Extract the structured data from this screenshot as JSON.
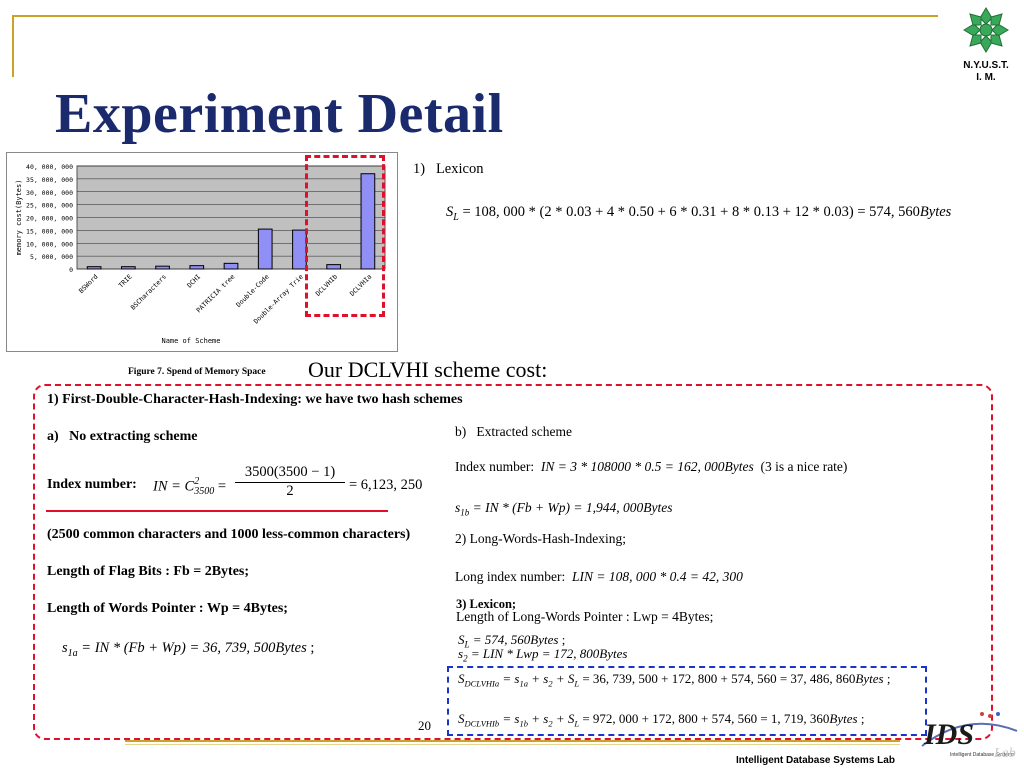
{
  "slide": {
    "title": "Experiment Detail",
    "org_logo_text": [
      "N.Y.U.S.T.",
      "I. M."
    ],
    "page_number": "20",
    "footer": "Intelligent Database Systems Lab",
    "ids_logo_text": "IDS",
    "ids_logo_sub": "Intelligent Database Systems",
    "ids_logo_lab": "Lab"
  },
  "figure": {
    "caption": "Figure 7. Spend of Memory Space"
  },
  "chart_data": {
    "type": "bar",
    "categories": [
      "BSWord",
      "TRIE",
      "BSCharacters",
      "DCHI",
      "PATRICIA tree",
      "Double-Code",
      "Double-Array Trie",
      "DCLVHIb",
      "DCLVHIa"
    ],
    "values": [
      900000,
      900000,
      1100000,
      1300000,
      2200000,
      15500000,
      15100000,
      1700000,
      37000000
    ],
    "ylim": [
      0,
      40000000
    ],
    "yticks": [
      "0",
      "5, 000, 000",
      "10, 000, 000",
      "15, 000, 000",
      "20, 000, 000",
      "25, 000, 000",
      "30, 000, 000",
      "35, 000, 000",
      "40, 000, 000"
    ],
    "ylabel": "memory cost(Bytes)",
    "xlabel": "Name of Scheme",
    "grid": true,
    "bar_color": "#8f8ff5",
    "plot_bg": "#c0c0c0"
  },
  "content": {
    "lexicon_heading": "1)   Lexicon",
    "lexicon_eq_lhs": "S",
    "lexicon_eq_sub": "L",
    "lexicon_eq_rhs": " = 108, 000 * (2 * 0.03 + 4 * 0.50 + 6 * 0.31 + 8 * 0.13 + 12 * 0.03) = 574, 560",
    "lexicon_eq_unit": "Bytes",
    "cost_title": "Our DCLVHI scheme cost:",
    "section1": "1) First-Double-Character-Hash-Indexing: we have two hash schemes",
    "a_heading": "a)   No extracting scheme",
    "a_index_label": "Index number:",
    "a_index_eq_pre": "IN = C",
    "a_index_eq_sup": "2",
    "a_index_eq_sub": "3500",
    "a_index_eq_num": "3500(3500 − 1)",
    "a_index_eq_den": "2",
    "a_index_eq_rhs": "= 6,123, 250",
    "a_chars_note": "(2500 common characters and 1000 less-common characters)",
    "a_flag_bits": "Length of Flag Bits : Fb = 2Bytes;",
    "a_words_pointer": "Length of Words Pointer : Wp = 4Bytes;",
    "a_s1a_lhs": "s",
    "a_s1a_sub": "1a",
    "a_s1a_rhs": " = IN * (Fb + Wp) = 36, 739, 500",
    "a_s1a_unit": "Bytes",
    "a_s1a_end": " ;",
    "b_heading": "b)   Extracted scheme",
    "b_index_label": "Index number:",
    "b_index_eq": "IN = 3 * 108000 * 0.5 = 162, 000",
    "b_index_unit": "Bytes",
    "b_index_note": "  (3 is a nice rate)",
    "b_s1b_lhs": "s",
    "b_s1b_sub": "1b",
    "b_s1b_rhs": " = IN * (Fb + Wp) = 1,944, 000",
    "b_s1b_unit": "Bytes",
    "section2": "2) Long-Words-Hash-Indexing;",
    "long_index_label": "Long index number:",
    "long_index_eq": "LIN = 108, 000 * 0.4 = 42, 300",
    "section3": "3) Lexicon;",
    "lwp": "Length of Long-Words Pointer : Lwp = 4Bytes;",
    "sl_lhs": "S",
    "sl_sub": "L",
    "sl_rhs": " = 574, 560",
    "sl_unit": "Bytes",
    "sl_end": " ;",
    "s2_lhs": "s",
    "s2_sub": "2",
    "s2_rhs": " = LIN * Lwp = 172, 800",
    "s2_unit": "Bytes",
    "sa_lhs": "S",
    "sa_sub": "DCLVHIa",
    "sa_rhs_a": " = s",
    "sa_rhs_sub1": "1a",
    "sa_rhs_b": " + s",
    "sa_rhs_sub2": "2",
    "sa_rhs_c": " + S",
    "sa_rhs_sub3": "L",
    "sa_rhs_d": " = 36, 739, 500 + 172, 800 + 574, 560 = 37, 486, 860",
    "sa_unit": "Bytes",
    "sa_end": " ;",
    "sb_lhs": "S",
    "sb_sub": "DCLVHIb",
    "sb_rhs_a": " = s",
    "sb_rhs_sub1": "1b",
    "sb_rhs_b": " + s",
    "sb_rhs_sub2": "2",
    "sb_rhs_c": " + S",
    "sb_rhs_sub3": "L",
    "sb_rhs_d": " = 972, 000 + 172, 800 + 574, 560 = 1, 719, 360",
    "sb_unit": "Bytes",
    "sb_end": " ;"
  }
}
